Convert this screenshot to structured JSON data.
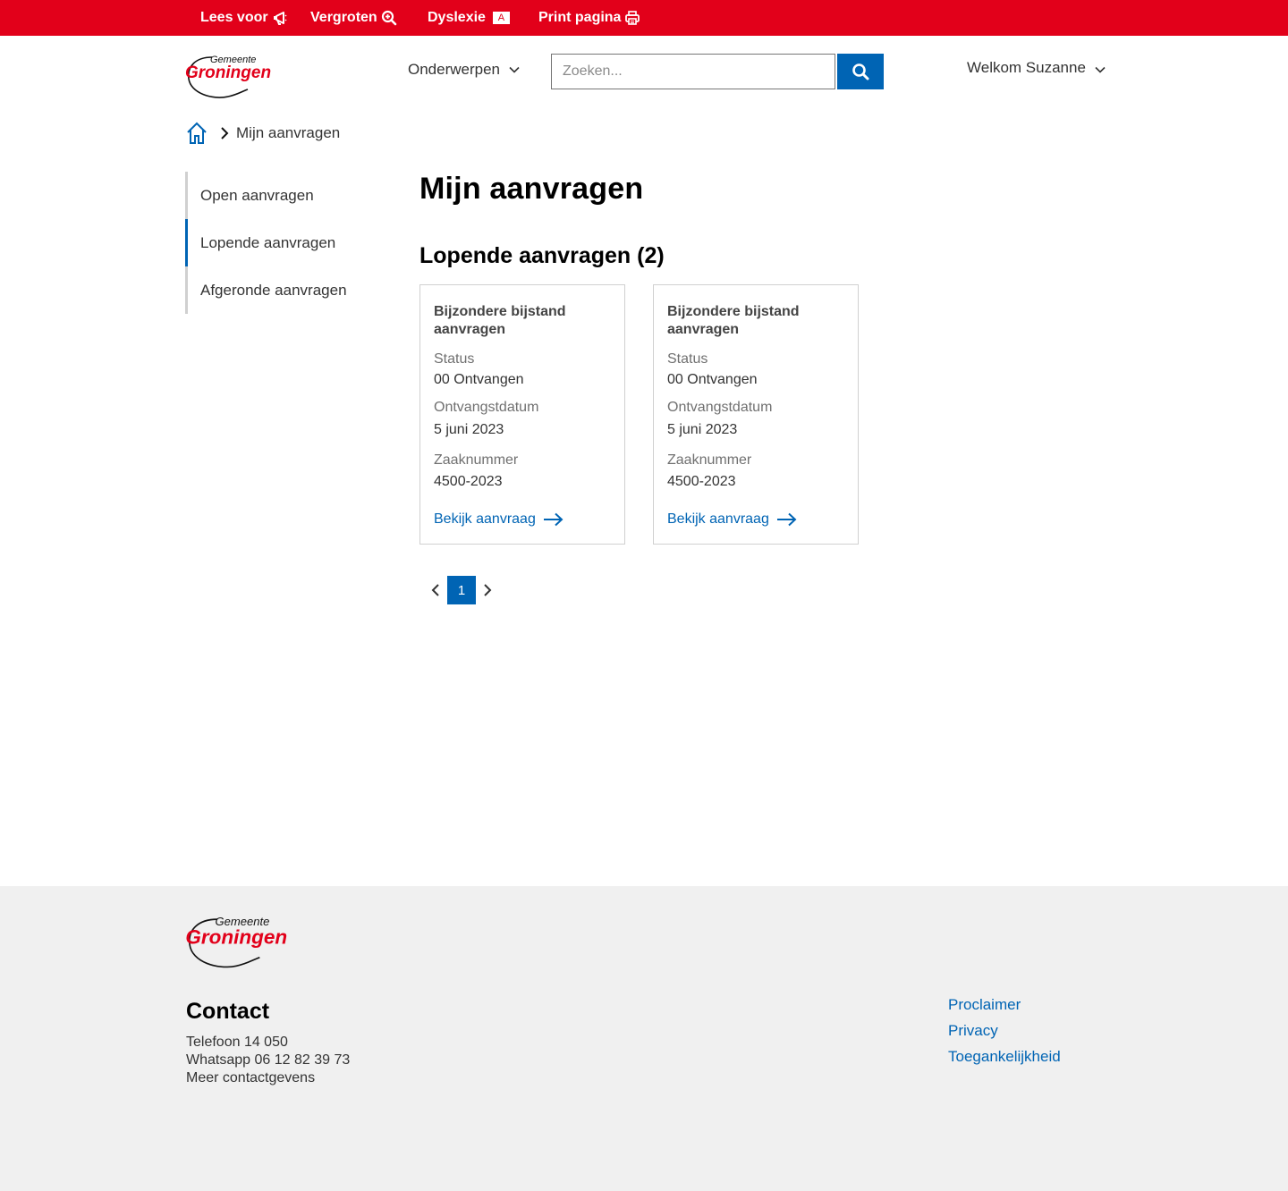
{
  "topbar": {
    "read_label": "Lees voor",
    "zoom_label": "Vergroten",
    "dyslexia_label": "Dyslexie",
    "dyslexia_badge": "A",
    "print_label": "Print pagina",
    "color": "#e2001a"
  },
  "logo": {
    "top_text": "Gemeente",
    "main_text": "Groningen"
  },
  "header": {
    "subjects_label": "Onderwerpen",
    "search_placeholder": "Zoeken...",
    "welcome_label": "Welkom Suzanne"
  },
  "breadcrumb": {
    "current": "Mijn aanvragen"
  },
  "sidebar": {
    "items": [
      {
        "label": "Open aanvragen",
        "active": false
      },
      {
        "label": "Lopende aanvragen",
        "active": true
      },
      {
        "label": "Afgeronde aanvragen",
        "active": false
      }
    ]
  },
  "main": {
    "title": "Mijn aanvragen",
    "section_title": "Lopende aanvragen (2)",
    "cards": [
      {
        "title_line1": "Bijzondere bijstand",
        "title_line2": "aanvragen",
        "status_label": "Status",
        "status_value": "00 Ontvangen",
        "date_label": "Ontvangstdatum",
        "date_value": "5 juni 2023",
        "case_label": "Zaaknummer",
        "case_value": "4500-2023",
        "link": "Bekijk aanvraag"
      },
      {
        "title_line1": "Bijzondere bijstand",
        "title_line2": "aanvragen",
        "status_label": "Status",
        "status_value": "00 Ontvangen",
        "date_label": "Ontvangstdatum",
        "date_value": "5 juni 2023",
        "case_label": "Zaaknummer",
        "case_value": "4500-2023",
        "link": "Bekijk aanvraag"
      }
    ],
    "pagination": {
      "current_page": "1"
    }
  },
  "footer": {
    "contact_title": "Contact",
    "phone": "Telefoon 14 050",
    "whatsapp": "Whatsapp 06 12 82 39 73",
    "more": "Meer contactgevens",
    "links": [
      "Proclaimer",
      "Privacy",
      "Toegankelijkheid"
    ]
  },
  "colors": {
    "brand_red": "#e2001a",
    "accent_blue": "#0064b4",
    "footer_bg": "#f0f0f0"
  }
}
